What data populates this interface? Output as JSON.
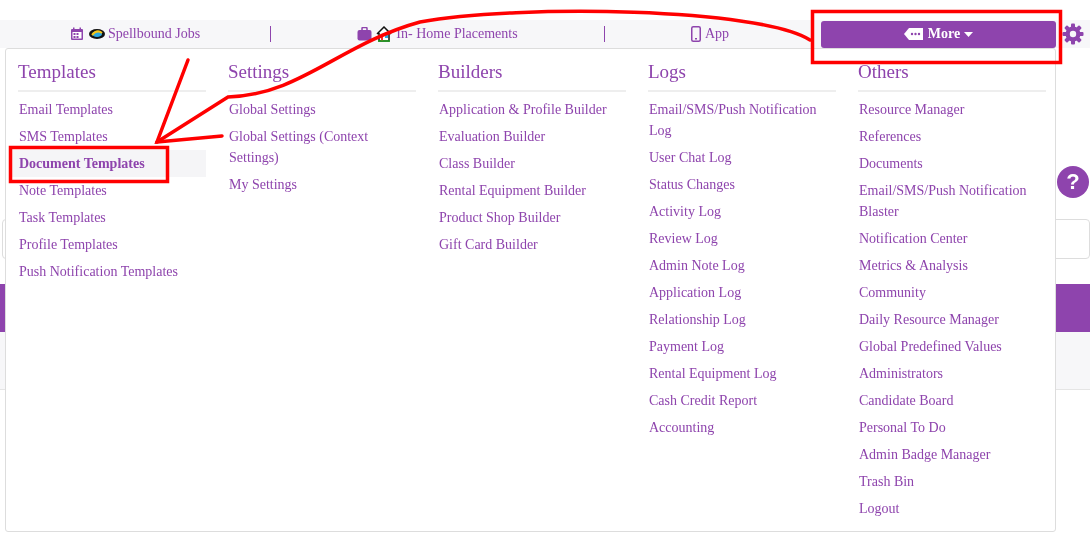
{
  "nav": {
    "items": [
      {
        "label": "Spellbound Jobs",
        "kind": "jobs"
      },
      {
        "label": "In- Home Placements",
        "kind": "placements"
      },
      {
        "label": "App",
        "kind": "app"
      }
    ],
    "more_button": {
      "label": "More",
      "expanded": true
    }
  },
  "menu": {
    "columns": [
      {
        "heading": "Templates",
        "items": [
          {
            "label": "Email Templates",
            "selected": false
          },
          {
            "label": "SMS Templates",
            "selected": false
          },
          {
            "label": "Document Templates",
            "selected": true
          },
          {
            "label": "Note Templates",
            "selected": false
          },
          {
            "label": "Task Templates",
            "selected": false
          },
          {
            "label": "Profile Templates",
            "selected": false
          },
          {
            "label": "Push Notification Templates",
            "selected": false
          }
        ]
      },
      {
        "heading": "Settings",
        "items": [
          {
            "label": "Global Settings",
            "selected": false
          },
          {
            "label": "Global Settings (Context Settings)",
            "selected": false
          },
          {
            "label": "My Settings",
            "selected": false
          }
        ]
      },
      {
        "heading": "Builders",
        "items": [
          {
            "label": "Application & Profile Builder",
            "selected": false
          },
          {
            "label": "Evaluation Builder",
            "selected": false
          },
          {
            "label": "Class Builder",
            "selected": false
          },
          {
            "label": "Rental Equipment Builder",
            "selected": false
          },
          {
            "label": "Product Shop Builder",
            "selected": false
          },
          {
            "label": "Gift Card Builder",
            "selected": false
          }
        ]
      },
      {
        "heading": "Logs",
        "items": [
          {
            "label": "Email/SMS/Push Notification Log",
            "selected": false
          },
          {
            "label": "User Chat Log",
            "selected": false
          },
          {
            "label": "Status Changes",
            "selected": false
          },
          {
            "label": "Activity Log",
            "selected": false
          },
          {
            "label": "Review Log",
            "selected": false
          },
          {
            "label": "Admin Note Log",
            "selected": false
          },
          {
            "label": "Application Log",
            "selected": false
          },
          {
            "label": "Relationship Log",
            "selected": false
          },
          {
            "label": "Payment Log",
            "selected": false
          },
          {
            "label": "Rental Equipment Log",
            "selected": false
          },
          {
            "label": "Cash Credit Report",
            "selected": false
          },
          {
            "label": "Accounting",
            "selected": false
          }
        ]
      },
      {
        "heading": "Others",
        "items": [
          {
            "label": "Resource Manager",
            "selected": false
          },
          {
            "label": "References",
            "selected": false
          },
          {
            "label": "Documents",
            "selected": false
          },
          {
            "label": "Email/SMS/Push Notification Blaster",
            "selected": false
          },
          {
            "label": "Notification Center",
            "selected": false
          },
          {
            "label": "Metrics & Analysis",
            "selected": false
          },
          {
            "label": "Community",
            "selected": false
          },
          {
            "label": "Daily Resource Manager",
            "selected": false
          },
          {
            "label": "Global Predefined Values",
            "selected": false
          },
          {
            "label": "Administrators",
            "selected": false
          },
          {
            "label": "Candidate Board",
            "selected": false
          },
          {
            "label": "Personal To Do",
            "selected": false
          },
          {
            "label": "Admin Badge Manager",
            "selected": false
          },
          {
            "label": "Trash Bin",
            "selected": false
          },
          {
            "label": "Logout",
            "selected": false
          }
        ]
      }
    ]
  },
  "help_button": {
    "label": "?"
  }
}
